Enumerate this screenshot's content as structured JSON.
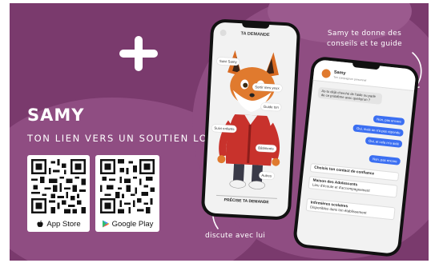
{
  "heading": {
    "title": "SAMY",
    "subtitle": "TON LIEN VERS UN SOUTIEN LOCAL"
  },
  "stores": {
    "apple_label": "App Store",
    "google_label": "Google Play",
    "apple_icon": "apple-icon",
    "google_icon": "google-play-icon"
  },
  "annotations": {
    "top_right": "Samy te donne des conseils et te guide",
    "bottom": "discute avec lui"
  },
  "phone1": {
    "header": "TA DEMANDE",
    "bubbles": [
      "Suivi Samy",
      "Sortir mes yeux",
      "Guide ton",
      "Suivi enfants",
      "Bâtiments",
      "Autres"
    ],
    "footer": "PRÉCISE TA DEMANDE"
  },
  "phone2": {
    "name": "Samy",
    "status": "Ton compagnon personnel",
    "messages": [
      {
        "dir": "in",
        "text": "As-tu déjà cherché de l'aide ou parlé de ce problème avec quelqu'un ?"
      },
      {
        "dir": "out",
        "text": "Non, pas encore"
      },
      {
        "dir": "out",
        "text": "Oui, mais on n'a pas répondu"
      },
      {
        "dir": "out",
        "text": "Oui, et cela m'a aidé"
      },
      {
        "dir": "out",
        "text": "Non, pas encore"
      }
    ],
    "options": [
      {
        "title": "Choisis ton contact de confiance",
        "desc": ""
      },
      {
        "title": "Maison des Adolescents",
        "desc": "Lieu d'écoute et d'accompagnement"
      },
      {
        "title": "Infirmières scolaires",
        "desc": "Disponibles dans ton établissement"
      }
    ]
  },
  "colors": {
    "background": "#7a3a6d",
    "blob": "#8f4d82",
    "accent_blue": "#3b6ff2",
    "fox_orange": "#e07a2e",
    "jacket_red": "#c8322c"
  }
}
